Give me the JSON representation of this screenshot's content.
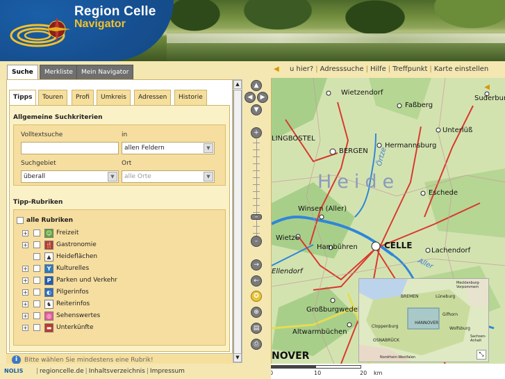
{
  "header": {
    "title": "Region Celle",
    "subtitle": "Navigator"
  },
  "main_tabs": [
    {
      "label": "Suche",
      "active": true
    },
    {
      "label": "Merkliste",
      "active": false
    },
    {
      "label": "Mein Navigator",
      "active": false
    }
  ],
  "toolbar": {
    "links": [
      "u hier?",
      "Adresssuche",
      "Hilfe",
      "Treffpunkt",
      "Karte einstellen"
    ]
  },
  "sub_tabs": [
    {
      "label": "Tipps",
      "active": true
    },
    {
      "label": "Touren",
      "active": false
    },
    {
      "label": "Profi",
      "active": false
    },
    {
      "label": "Umkreis",
      "active": false
    },
    {
      "label": "Adressen",
      "active": false
    },
    {
      "label": "Historie",
      "active": false
    }
  ],
  "criteria": {
    "title": "Allgemeine Suchkriterien",
    "fulltext_label": "Volltextsuche",
    "fulltext_value": "",
    "in_label": "in",
    "in_value": "allen Feldern",
    "area_label": "Suchgebiet",
    "area_value": "überall",
    "place_label": "Ort",
    "place_value": "alle Orte"
  },
  "rubrics": {
    "title": "Tipp-Rubriken",
    "all_label": "alle Rubriken",
    "items": [
      {
        "label": "Freizeit",
        "icon": "leisure-icon",
        "color": "#5fa63b",
        "glyph": "☺",
        "expandable": true
      },
      {
        "label": "Gastronomie",
        "icon": "gastronomy-icon",
        "color": "#c0392b",
        "glyph": "🍴",
        "expandable": true
      },
      {
        "label": "Heideflächen",
        "icon": "heath-icon",
        "color": "#ffffff",
        "glyph": "▲",
        "expandable": false
      },
      {
        "label": "Kulturelles",
        "icon": "culture-icon",
        "color": "#2b7bbf",
        "glyph": "Y",
        "expandable": true
      },
      {
        "label": "Parken und Verkehr",
        "icon": "parking-icon",
        "color": "#1f5fb0",
        "glyph": "P",
        "expandable": true
      },
      {
        "label": "Pilgerinfos",
        "icon": "pilgrim-icon",
        "color": "#2b6fc0",
        "glyph": "◐",
        "expandable": true
      },
      {
        "label": "Reiterinfos",
        "icon": "horse-icon",
        "color": "#ffffff",
        "glyph": "♞",
        "expandable": true
      },
      {
        "label": "Sehenswertes",
        "icon": "sights-icon",
        "color": "#e85a9a",
        "glyph": "◎",
        "expandable": true
      },
      {
        "label": "Unterkünfte",
        "icon": "lodging-icon",
        "color": "#c0392b",
        "glyph": "▬",
        "expandable": true
      }
    ]
  },
  "hint": "Bitte wählen Sie mindestens eine Rubrik!",
  "footer": {
    "brand": "NOLIS",
    "links": [
      "regioncelle.de",
      "Inhaltsverzeichnis",
      "Impressum"
    ]
  },
  "map": {
    "region_label": "Heide",
    "places": [
      "Wietzendorf",
      "Faßberg",
      "Suderburg",
      "Unterlüß",
      "LINGBOSTEL",
      "BERGEN",
      "Hermannsburg",
      "Eschede",
      "Winsen (Aller)",
      "Wietze",
      "Hambühren",
      "CELLE",
      "Lachendorf",
      "Großburgwedel",
      "Altwarmbüchen",
      "NOVER",
      "Ellendorf"
    ],
    "rivers": [
      "Örtze",
      "Aller"
    ],
    "scale": {
      "labels": [
        "0",
        "10",
        "20"
      ],
      "unit": "km"
    }
  },
  "minimap": {
    "places": [
      "BREMEN",
      "Lüneburg",
      "Gifhorn",
      "HANNOVER",
      "Sachsen-Anhalt",
      "Mecklenburg-Vorpommern",
      "Cloppenburg",
      "OSNABRÜCK",
      "Wolfsburg",
      "Nordrhein-Westfalen"
    ]
  }
}
